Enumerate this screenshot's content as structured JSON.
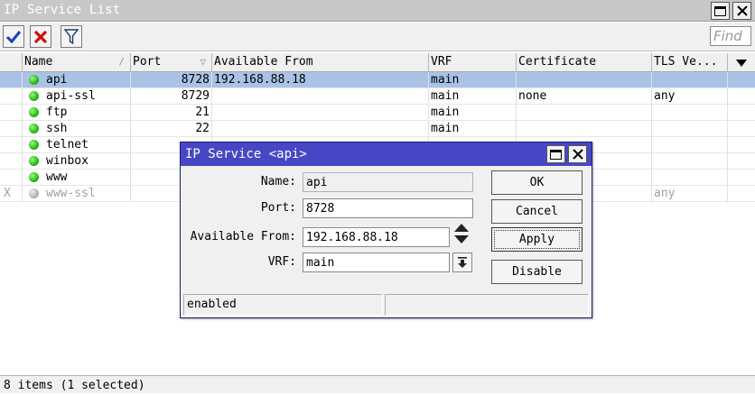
{
  "window": {
    "title": "IP Service List"
  },
  "toolbar": {
    "find_placeholder": "Find"
  },
  "table": {
    "columns": [
      "Name",
      "Port",
      "Available From",
      "VRF",
      "Certificate",
      "TLS Ve..."
    ],
    "rows": [
      {
        "flag": "",
        "name": "api",
        "port": "8728",
        "available_from": "192.168.88.18",
        "vrf": "main",
        "certificate": "",
        "tls": "",
        "status": "enabled"
      },
      {
        "flag": "",
        "name": "api-ssl",
        "port": "8729",
        "available_from": "",
        "vrf": "main",
        "certificate": "none",
        "tls": "any",
        "status": "enabled"
      },
      {
        "flag": "",
        "name": "ftp",
        "port": "21",
        "available_from": "",
        "vrf": "main",
        "certificate": "",
        "tls": "",
        "status": "enabled"
      },
      {
        "flag": "",
        "name": "ssh",
        "port": "22",
        "available_from": "",
        "vrf": "main",
        "certificate": "",
        "tls": "",
        "status": "enabled"
      },
      {
        "flag": "",
        "name": "telnet",
        "port": "",
        "available_from": "",
        "vrf": "",
        "certificate": "",
        "tls": "",
        "status": "enabled"
      },
      {
        "flag": "",
        "name": "winbox",
        "port": "",
        "available_from": "",
        "vrf": "",
        "certificate": "",
        "tls": "",
        "status": "enabled"
      },
      {
        "flag": "",
        "name": "www",
        "port": "",
        "available_from": "",
        "vrf": "",
        "certificate": "",
        "tls": "",
        "status": "enabled"
      },
      {
        "flag": "X",
        "name": "www-ssl",
        "port": "",
        "available_from": "",
        "vrf": "",
        "certificate": "",
        "tls": "any",
        "status": "disabled"
      }
    ]
  },
  "statusbar": {
    "text": "8 items (1 selected)"
  },
  "dialog": {
    "title": "IP Service <api>",
    "labels": {
      "name": "Name:",
      "port": "Port:",
      "available_from": "Available From:",
      "vrf": "VRF:"
    },
    "values": {
      "name": "api",
      "port": "8728",
      "available_from": "192.168.88.18",
      "vrf": "main"
    },
    "buttons": {
      "ok": "OK",
      "cancel": "Cancel",
      "apply": "Apply",
      "disable": "Disable"
    },
    "status": "enabled"
  },
  "colors": {
    "dialog_title_bg": "#4747c5",
    "selected_row_bg": "#a9c3e6",
    "status_enabled": "#2fbf1a",
    "status_disabled": "#b8b8b8",
    "check_icon": "#1a3fbf",
    "cross_icon": "#cc1111"
  },
  "icons": {
    "enable": "check-icon",
    "disable": "cross-icon",
    "filter": "filter-icon",
    "maximize": "maximize-icon",
    "close": "close-icon",
    "column_menu": "chevron-down-icon"
  }
}
